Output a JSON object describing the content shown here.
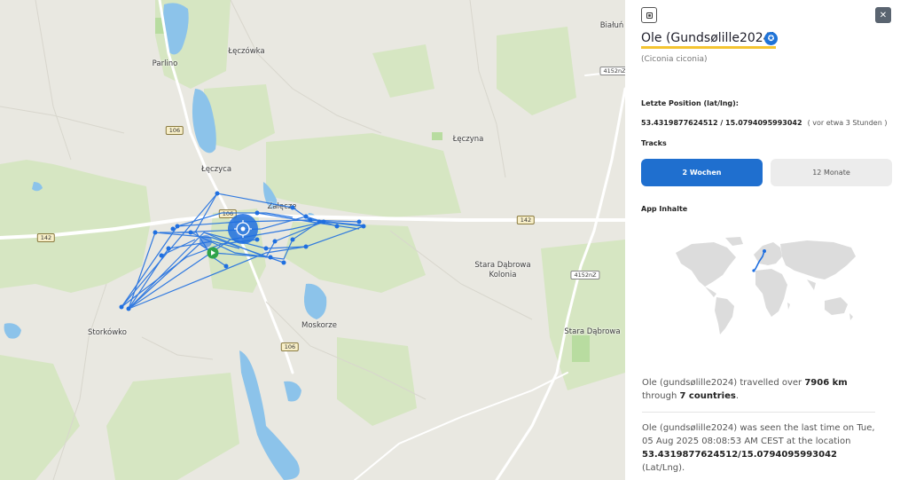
{
  "map": {
    "places": [
      {
        "name": "Parlino",
        "id": "parlino"
      },
      {
        "name": "Łęczówka",
        "id": "leczowka"
      },
      {
        "name": "Łęczyca",
        "id": "leczyca"
      },
      {
        "name": "Załęcze",
        "id": "zalecze"
      },
      {
        "name": "Łęczyna",
        "id": "leczyna"
      },
      {
        "name": "Stara Dąbrowa\nKolonia",
        "id": "stara-dabrowa-kolonia"
      },
      {
        "name": "Stara Dąbrowa",
        "id": "stara-dabrowa"
      },
      {
        "name": "Storkówko",
        "id": "storkowko"
      },
      {
        "name": "Moskorze",
        "id": "moskorze"
      },
      {
        "name": "Białuń",
        "id": "bialun"
      }
    ],
    "shields": {
      "r106a": "106",
      "r106b": "106",
      "r106c": "106",
      "r142a": "142",
      "r142b": "142",
      "r4152a": "4152nZ",
      "r4152b": "4152nZ"
    },
    "track_color": "#1f6fe0",
    "road_color": "#ffffff"
  },
  "panel": {
    "share_icon": "share-icon",
    "close_icon": "close-icon",
    "title": "Ole (Gundsølille2024)",
    "verified_icon": "verified-badge-icon",
    "species": "(Ciconia ciconia)",
    "last_position_label": "Letzte Position (lat/lng):",
    "coords": "53.4319877624512 / 15.0794095993042",
    "coords_ago": "( vor etwa 3 Stunden )",
    "tracks_label": "Tracks",
    "tab_2w": "2 Wochen",
    "tab_12m": "12 Monate",
    "app_label": "App Inhalte",
    "stat1": {
      "pre": "Ole (gundsølille2024) travelled over ",
      "distance": "7906 km",
      "mid": "through ",
      "countries": "7 countries",
      "post": "."
    },
    "stat2": {
      "pre": "Ole (gundsølille2024) was seen the last time on Tue, 05 Aug 2025 08:08:53 AM CEST at the location ",
      "coords": "53.4319877624512/15.0794095993042",
      "post": " (Lat/Lng)."
    },
    "accent": "#1f6fcf",
    "highlight": "#f4c430"
  }
}
